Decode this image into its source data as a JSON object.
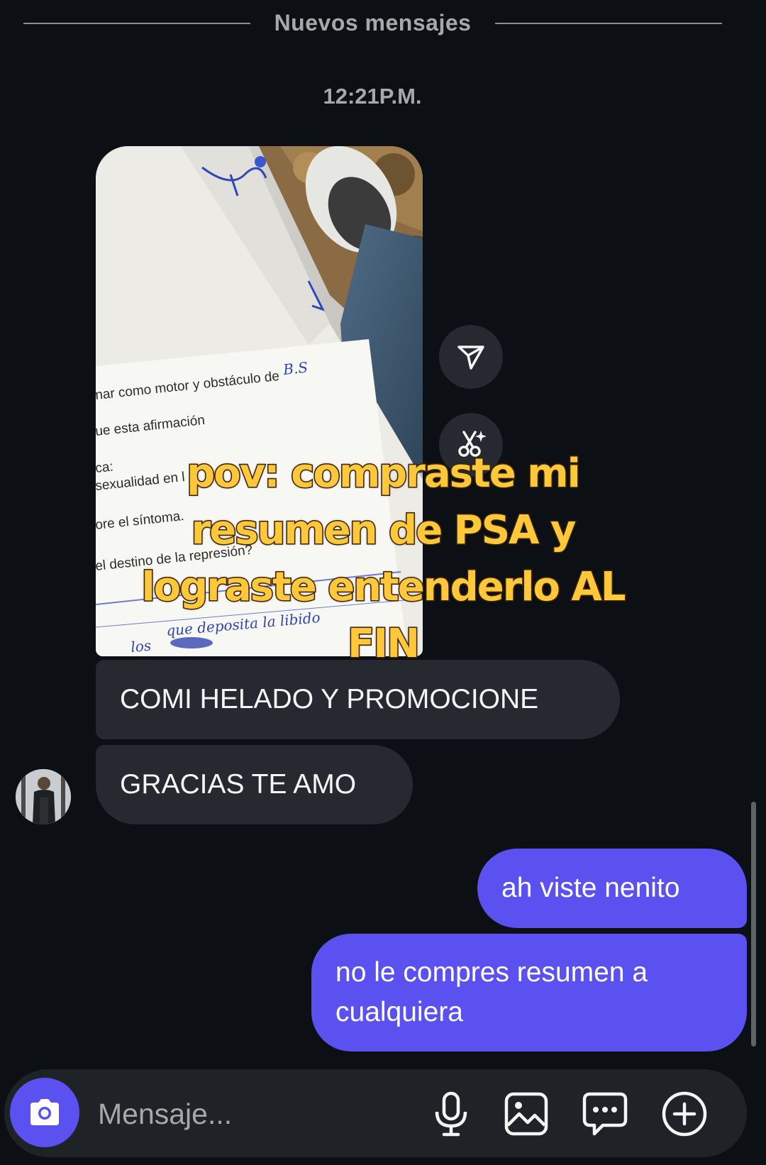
{
  "divider": {
    "label": "Nuevos mensajes"
  },
  "timestamp": "12:21P.M.",
  "photo": {
    "paper_lines": [
      "nar como motor y obstáculo de",
      "ue esta afirmación",
      "ca:",
      "sexualidad en l",
      "ore el síntoma.",
      "el destino de la represión?"
    ],
    "handwriting": [
      "B.S",
      "que deposita la libido",
      "los"
    ]
  },
  "overlay_caption": [
    "pov: compraste mi",
    "resumen de PSA y",
    "lograste entenderlo AL",
    "FIN"
  ],
  "messages": {
    "received": [
      {
        "text": "COMI HELADO Y PROMOCIONE"
      },
      {
        "text": "GRACIAS TE AMO"
      }
    ],
    "sent": [
      {
        "text": "ah viste nenito"
      },
      {
        "text": "no le compres resumen a cualquiera"
      }
    ]
  },
  "composer": {
    "placeholder": "Mensaje...",
    "icons": [
      "camera-icon",
      "microphone-icon",
      "image-icon",
      "sticker-icon",
      "plus-icon"
    ]
  },
  "colors": {
    "background": "#0c1014",
    "incoming_bubble": "#262a30",
    "outgoing_bubble": "#5b50f0",
    "caption": "#ffc83a"
  }
}
